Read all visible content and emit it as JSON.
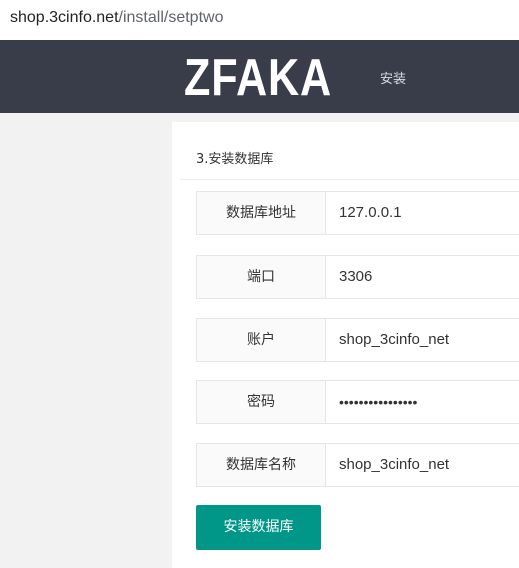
{
  "browser": {
    "url_host": "shop.3cinfo.net",
    "url_path": "/install/setptwo"
  },
  "header": {
    "logo": "ZFAKA",
    "nav_install": "安装"
  },
  "form": {
    "step_title": "3.安装数据库",
    "fields": [
      {
        "label": "数据库地址",
        "value": "127.0.0.1"
      },
      {
        "label": "端口",
        "value": "3306"
      },
      {
        "label": "账户",
        "value": "shop_3cinfo_net"
      },
      {
        "label": "密码",
        "value": "••••••••••••••••"
      },
      {
        "label": "数据库名称",
        "value": "shop_3cinfo_net"
      }
    ],
    "submit_label": "安装数据库"
  },
  "colors": {
    "header_bg": "#393d49",
    "button_bg": "#009688",
    "page_bg": "#f2f2f2"
  }
}
